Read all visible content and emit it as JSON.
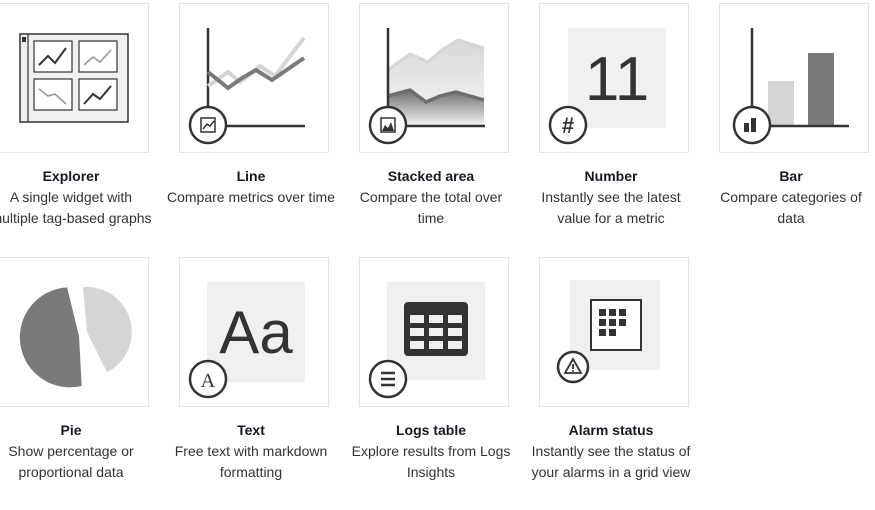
{
  "widgets": [
    {
      "title": "Explorer",
      "description": "A single widget with multiple tag-based graphs",
      "icon": "explorer-grid-icon"
    },
    {
      "title": "Line",
      "description": "Compare metrics over time",
      "icon": "line-chart-icon"
    },
    {
      "title": "Stacked area",
      "description": "Compare the total over time",
      "icon": "stacked-area-icon"
    },
    {
      "title": "Number",
      "description": "Instantly see the latest value for a metric",
      "icon": "number-icon",
      "number_value": "11"
    },
    {
      "title": "Bar",
      "description": "Compare categories of data",
      "icon": "bar-chart-icon"
    },
    {
      "title": "Pie",
      "description": "Show percentage or proportional data",
      "icon": "pie-chart-icon"
    },
    {
      "title": "Text",
      "description": "Free text with markdown formatting",
      "icon": "text-icon",
      "sample_text": "Aa"
    },
    {
      "title": "Logs table",
      "description": "Explore results from Logs Insights",
      "icon": "logs-table-icon"
    },
    {
      "title": "Alarm status",
      "description": "Instantly see the status of your alarms in a grid view",
      "icon": "alarm-status-icon"
    }
  ],
  "colors": {
    "border": "#e3e3e3",
    "dark": "#333333",
    "mid": "#7a7a7a",
    "light": "#d5d5d5",
    "panel": "#f0f0f0"
  }
}
